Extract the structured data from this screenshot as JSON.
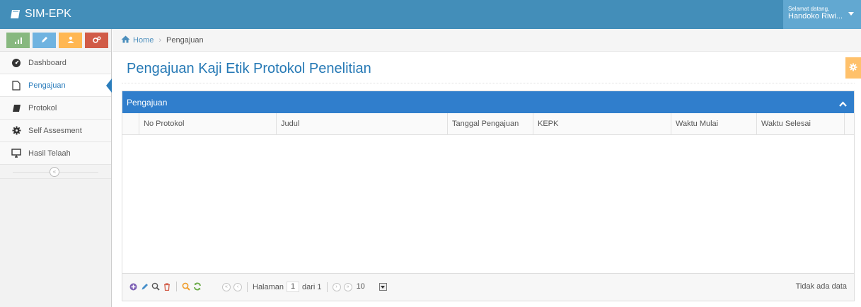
{
  "app": {
    "brand": "SIM-EPK"
  },
  "user": {
    "welcome": "Selamat datang,",
    "name": "Handoko Riwi..."
  },
  "sidebar": {
    "items": [
      {
        "label": "Dashboard",
        "icon": "dashboard-icon"
      },
      {
        "label": "Pengajuan",
        "icon": "file-icon",
        "active": true
      },
      {
        "label": "Protokol",
        "icon": "book-icon"
      },
      {
        "label": "Self Assesment",
        "icon": "gear-icon"
      },
      {
        "label": "Hasil Telaah",
        "icon": "monitor-icon"
      }
    ],
    "collapse_glyph": "«"
  },
  "breadcrumb": {
    "home": "Home",
    "current": "Pengajuan"
  },
  "page": {
    "title": "Pengajuan Kaji Etik Protokol Penelitian"
  },
  "grid": {
    "caption": "Pengajuan",
    "columns": [
      "No Protokol",
      "Judul",
      "Tanggal Pengajuan",
      "KEPK",
      "Waktu Mulai",
      "Waktu Selesai"
    ],
    "rows": [],
    "pager": {
      "page_label": "Halaman",
      "page_value": "1",
      "of_label": "dari 1",
      "rows_per_page": "10",
      "info": "Tidak ada data"
    }
  },
  "colors": {
    "navbar": "#438eb9",
    "accent_blue": "#307ecc",
    "title_blue": "#2679b5",
    "green": "#87b87f",
    "yellow": "#ffb752",
    "red": "#d15b47"
  }
}
